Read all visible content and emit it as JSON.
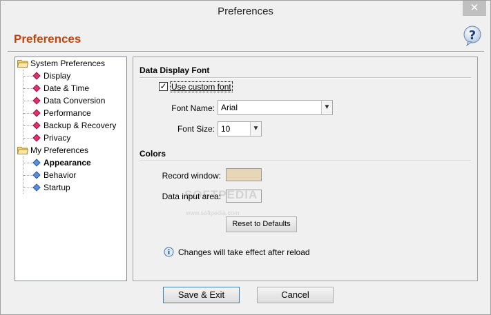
{
  "window": {
    "title": "Preferences",
    "close_glyph": "✕"
  },
  "header": {
    "heading": "Preferences",
    "help_icon": "help-icon"
  },
  "tree": {
    "groups": [
      {
        "label": "System Preferences",
        "items": [
          "Display",
          "Date & Time",
          "Data Conversion",
          "Performance",
          "Backup & Recovery",
          "Privacy"
        ]
      },
      {
        "label": "My Preferences",
        "items": [
          "Appearance",
          "Behavior",
          "Startup"
        ],
        "selected": "Appearance"
      }
    ]
  },
  "data_display_font": {
    "section_title": "Data Display Font",
    "use_custom_font_label": "Use custom font",
    "use_custom_font_checked": true,
    "font_name_label": "Font Name:",
    "font_name_value": "Arial",
    "font_size_label": "Font Size:",
    "font_size_value": "10"
  },
  "colors": {
    "section_title": "Colors",
    "record_window_label": "Record window:",
    "record_window_color": "#e8d6b8",
    "data_input_area_label": "Data input area:",
    "data_input_area_color": "#f0f0f0",
    "reset_button": "Reset to Defaults"
  },
  "info": {
    "icon": "info-icon",
    "text": "Changes will take effect after reload"
  },
  "footer": {
    "save_exit": "Save & Exit",
    "cancel": "Cancel"
  },
  "watermark": {
    "text": "SOFTPEDIA",
    "sub": "www.softpedia.com"
  },
  "theme": {
    "heading_color": "#c0440f",
    "tree_pink": "#e0306e",
    "tree_blue": "#5b8fd6"
  }
}
